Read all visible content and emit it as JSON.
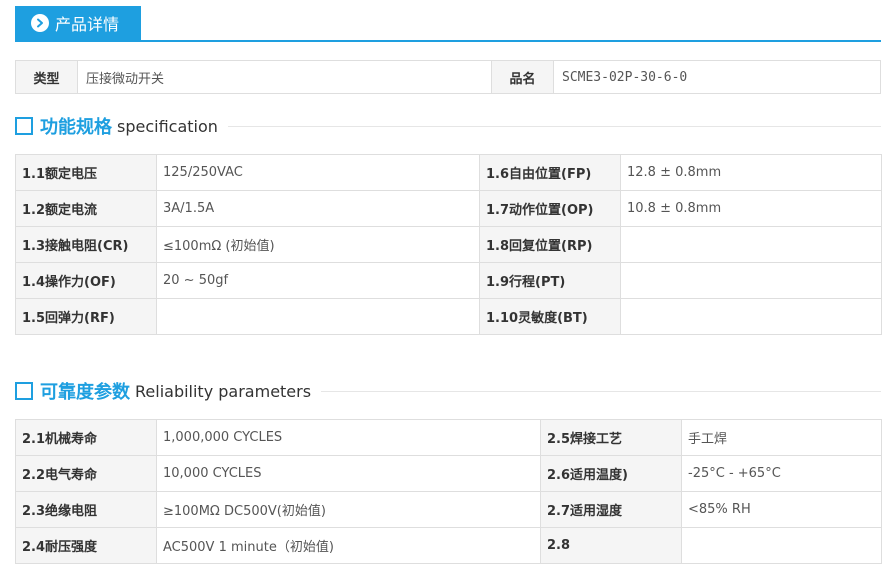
{
  "tab": {
    "label": "产品详情"
  },
  "product": {
    "type_label": "类型",
    "type_value": "压接微动开关",
    "name_label": "品名",
    "name_value": "SCME3-02P-30-6-0"
  },
  "spec": {
    "title": "功能规格",
    "subtitle": "specification",
    "rows": [
      {
        "k1": "1.1额定电压",
        "v1": "125/250VAC",
        "k2": "1.6自由位置(FP)",
        "v2": "12.8 ± 0.8mm"
      },
      {
        "k1": "1.2额定电流",
        "v1": "3A/1.5A",
        "k2": "1.7动作位置(OP)",
        "v2": "10.8 ± 0.8mm"
      },
      {
        "k1": "1.3接触电阻(CR)",
        "v1": "≤100mΩ (初始值)",
        "k2": "1.8回复位置(RP)",
        "v2": ""
      },
      {
        "k1": "1.4操作力(OF)",
        "v1": "20 ~ 50gf",
        "k2": "1.9行程(PT)",
        "v2": ""
      },
      {
        "k1": "1.5回弹力(RF)",
        "v1": "",
        "k2": "1.10灵敏度(BT)",
        "v2": ""
      }
    ]
  },
  "reliability": {
    "title": "可靠度参数",
    "subtitle": "Reliability parameters",
    "rows": [
      {
        "k1": "2.1机械寿命",
        "v1": "1,000,000 CYCLES",
        "k2": "2.5焊接工艺",
        "v2": "手工焊"
      },
      {
        "k1": "2.2电气寿命",
        "v1": "10,000  CYCLES",
        "k2": "2.6适用温度)",
        "v2": "-25°C - +65°C"
      },
      {
        "k1": "2.3绝缘电阻",
        "v1": "≥100MΩ DC500V(初始值)",
        "k2": "2.7适用湿度",
        "v2": "<85% RH"
      },
      {
        "k1": "2.4耐压强度",
        "v1": "AC500V 1 minute（初始值)",
        "k2": "2.8",
        "v2": ""
      }
    ]
  }
}
